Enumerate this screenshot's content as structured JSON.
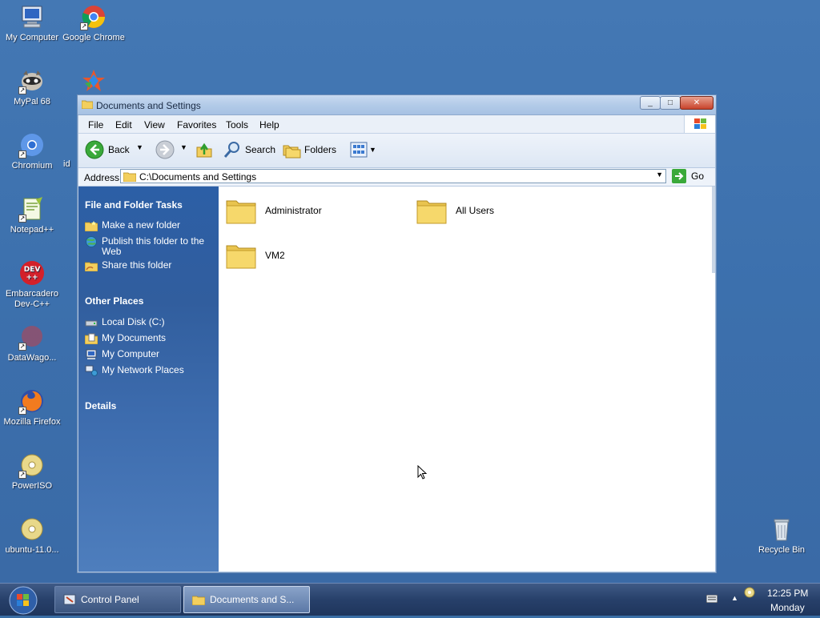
{
  "desktop": {
    "icons": [
      {
        "label": "My Computer",
        "icon": "my-computer-icon"
      },
      {
        "label": "Google Chrome",
        "icon": "chrome-icon"
      },
      {
        "label": "MyPal 68",
        "icon": "mypal-icon"
      },
      {
        "label": "Chromium",
        "icon": "chromium-icon"
      },
      {
        "label": "id",
        "icon": "app-icon"
      },
      {
        "label": "Notepad++",
        "icon": "notepadpp-icon"
      },
      {
        "label": "Embarcadero Dev-C++",
        "icon": "devcpp-icon"
      },
      {
        "label": "DataWago...",
        "icon": "datawagon-icon"
      },
      {
        "label": "Mozilla Firefox",
        "icon": "firefox-icon"
      },
      {
        "label": "PowerISO",
        "icon": "poweriso-icon"
      },
      {
        "label": "ubuntu-11.0...",
        "icon": "disc-icon"
      },
      {
        "label": "Recycle Bin",
        "icon": "recycle-bin-icon"
      }
    ]
  },
  "window": {
    "title": "Documents and Settings",
    "menu": [
      "File",
      "Edit",
      "View",
      "Favorites",
      "Tools",
      "Help"
    ],
    "toolbar": {
      "back": "Back",
      "search": "Search",
      "folders": "Folders"
    },
    "address": {
      "label": "Address",
      "value": "C:\\Documents and Settings",
      "go": "Go"
    },
    "taskpane": {
      "file_tasks_title": "File and Folder Tasks",
      "file_tasks": [
        "Make a new folder",
        "Publish this folder to the Web",
        "Share this folder"
      ],
      "other_places_title": "Other Places",
      "other_places": [
        "Local Disk (C:)",
        "My Documents",
        "My Computer",
        "My Network Places"
      ],
      "details_title": "Details"
    },
    "folders": [
      "Administrator",
      "All Users",
      "VM2"
    ]
  },
  "taskbar": {
    "buttons": [
      "Control Panel",
      "Documents and S..."
    ],
    "clock_time": "12:25 PM",
    "clock_day": "Monday"
  },
  "colors": {
    "desktop": "#3a6ea5",
    "taskpane": "#2c5fa6",
    "folder": "#f6d86b"
  }
}
